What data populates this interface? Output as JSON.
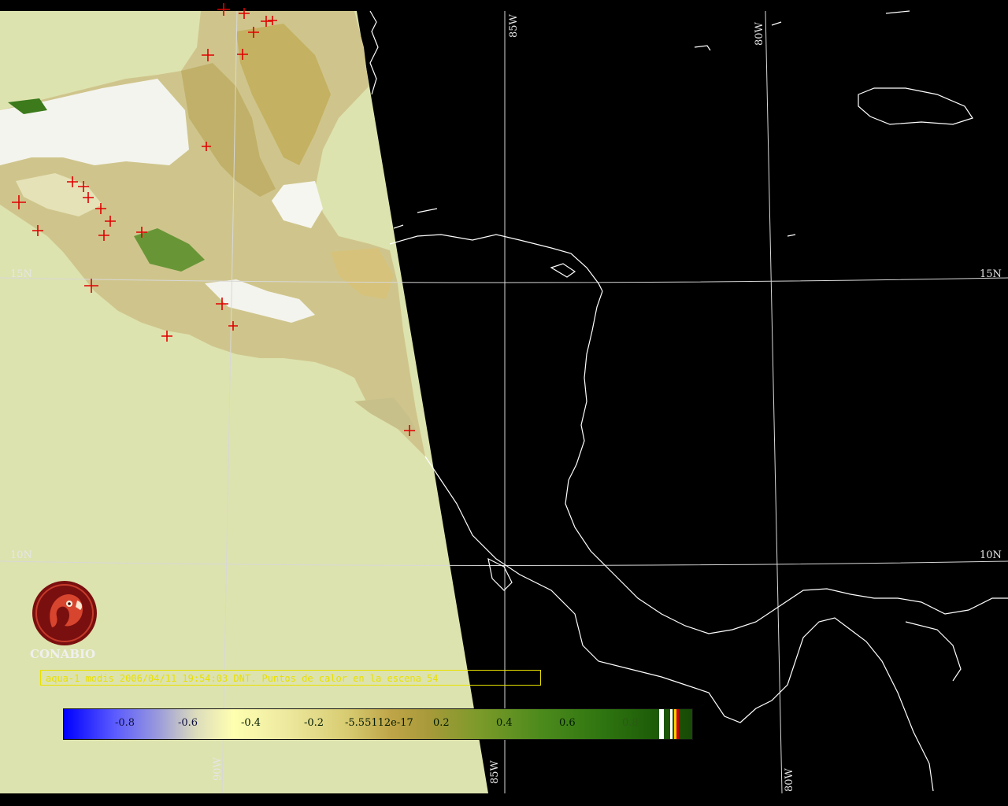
{
  "map": {
    "latitude_labels": [
      {
        "text": "15N"
      },
      {
        "text": "10N"
      }
    ],
    "longitude_labels": [
      {
        "text": "85W"
      },
      {
        "text": "80W"
      },
      {
        "text": "90W"
      }
    ],
    "colors": {
      "background_land_no_data": "#dde3ae",
      "ocean": "#000000",
      "coastline": "#ffffff",
      "fire_marker": "#e00000",
      "grid": "#d8d8d8"
    }
  },
  "caption": {
    "text": "aqua-1 modis 2006/04/11 19:54:03 DNT. Puntos de calor en la escena 54"
  },
  "colorbar": {
    "ticks": [
      "-0.8",
      "-0.6",
      "-0.4",
      "-0.2",
      "-5.55112e-17",
      "0.2",
      "0.4",
      "0.6",
      "0.8"
    ]
  },
  "logo": {
    "name": "CONABIO",
    "icon": "conabio-macaw-seal-icon"
  }
}
